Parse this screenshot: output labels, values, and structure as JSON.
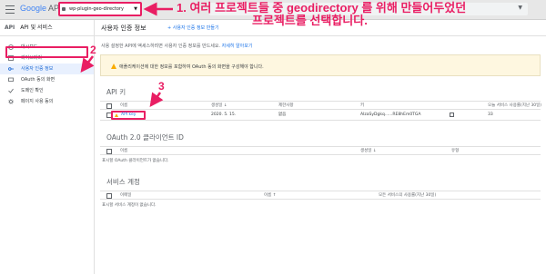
{
  "topbar": {
    "logo_google": "Google",
    "logo_apis": " APIs",
    "project_name": "wp-plugin-geo-directory",
    "project_caret": "▼",
    "search_caret": "▼"
  },
  "sidebar": {
    "api_badge": "API",
    "title": "API 및 서비스",
    "items": [
      {
        "label": "대시보드",
        "icon": "dashboard-icon"
      },
      {
        "label": "라이브러리",
        "icon": "library-icon"
      },
      {
        "label": "사용자 인증 정보",
        "icon": "key-icon",
        "active": true
      },
      {
        "label": "OAuth 동의 화면",
        "icon": "consent-icon"
      },
      {
        "label": "도메인 확인",
        "icon": "check-icon"
      },
      {
        "label": "페이지 사용 동의",
        "icon": "settings-icon"
      }
    ]
  },
  "header": {
    "title": "사용자 인증 정보",
    "create_button": "+ 사용자 인증 정보 만들기"
  },
  "main": {
    "intro": "사용 설정한 API에 액세스하려면 사용자 인증 정보를 만드세요.",
    "intro_link": "자세히 알아보기",
    "warning": "애플리케이션에 대한 정보를 포함하여 OAuth 동의 화면을 구성해야 합니다.",
    "api_keys": {
      "title": "API 키",
      "columns": [
        "이름",
        "생성일 ↓",
        "제한사항",
        "키",
        "오늘 서비스 사용률(지난 30일)"
      ],
      "rows": [
        {
          "name": "API key",
          "created": "2020. 5. 15.",
          "restriction": "없음",
          "key": "AIzaSyDgkq......RE8hEm0TGA",
          "usage": "33"
        }
      ]
    },
    "oauth": {
      "title": "OAuth 2.0 클라이언트 ID",
      "columns": [
        "이름",
        "생성일 ↓",
        "유형"
      ],
      "empty": "표시할 OAuth 클라이언트가 없습니다."
    },
    "service_accounts": {
      "title": "서비스 계정",
      "columns": [
        "이메일",
        "이름 ↑",
        "모든 서비스의 사용률(지난 30일)"
      ],
      "empty": "표시할 서비스 계정이 없습니다."
    }
  },
  "annotations": {
    "step1_number": "1.",
    "step1_line1": "여러 프로젝트들 중 geodirectory 를 위해 만들어두었던",
    "step1_line2": "프로젝트를 선택합니다.",
    "step2": "2",
    "step3": "3"
  },
  "colors": {
    "annotation": "#e91e63",
    "accent": "#1a73e8",
    "warning": "#f9ab00"
  }
}
